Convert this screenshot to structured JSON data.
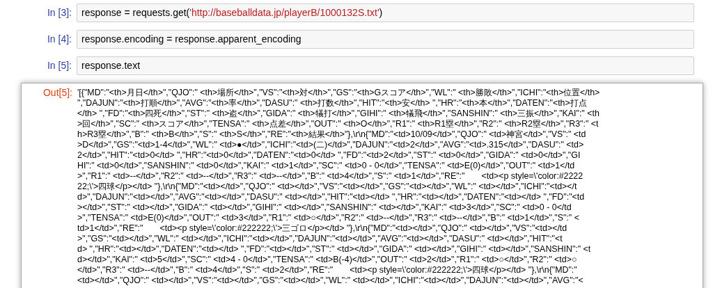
{
  "cells": [
    {
      "kind": "input",
      "prompt": "In [3]:",
      "code": [
        {
          "kind": "plain",
          "text": "response = requests.get("
        },
        {
          "kind": "string",
          "text": "'http://baseballdata.jp/playerB/1000132S.txt'"
        },
        {
          "kind": "plain",
          "text": ")"
        }
      ]
    },
    {
      "kind": "input",
      "prompt": "In [4]:",
      "code": [
        {
          "kind": "plain",
          "text": "response.encoding = response.apparent_encoding"
        }
      ]
    },
    {
      "kind": "input",
      "prompt": "In [5]:",
      "code": [
        {
          "kind": "plain",
          "text": "response.text"
        }
      ]
    },
    {
      "kind": "output",
      "prompt": "Out[5]:",
      "lines": [
        "'[{\"MD\":\"<th>月日</th>\",\"QJO\":\" <th>場所</th>\",\"VS\":\"<th>対</th>\",\"GS\":\"<th>Gスコア</th>\",\"WL\":\" <th>勝敗</th>\",\"ICHI\":\"<th>位置</th>",
        "\",\"DAJUN\":\"<th>打順</th>\",\"AVG\":\"<th>率</th>\",\"DASU\":\" <th>打数</th>\",\"HIT\":\"<th>安</th> \",\"HR\":\"<th>本</th>\",\"DATEN\":\"<th>打点",
        "</th> \",\"FD\":\"<th>四死</th>\",\"ST\":\" <th>盗</th>\",\"GIDA\":\" <th>犠打</th>\",\"GIHI\":\" <th>犠飛</th>\",\"SANSHIN\":\" <th>三振</th>\",\"KAI\":\" <th",
        ">回</th>\",\"SC\":\" <th>スコア</th>\",\"TENSA\":\" <th>点差</th>\",\"OUT\":\" <th>O</th>\",\"R1\":\" <th>R1塁</th>\",\"R2\":\" <th>R2塁</th>\",\"R3\":\" <t",
        "h>R3塁</th>\",\"B\":\" <th>B</th>\",\"S\":\" <th>S</th>\",\"RE\":\"<th>結果</th>\"},\\r\\n{\"MD\":\"<td>10/09</td>\",\"QJO\":\" <td>神宮</td>\",\"VS\":\" <td",
        ">D</td>\",\"GS\":\"<td>1-4</td>\",\"WL\":\" <td>●</td>\",\"ICHI\":\"<td>(二)</td>\",\"DAJUN\":\"<td>2</td>\",\"AVG\":\"<td>.315</td>\",\"DASU\":\" <td>",
        "2</td>\",\"HIT\":\"<td>0</td> \",\"HR\":\"<td>0</td>\",\"DATEN\":\"<td>0</td> \",\"FD\":\"<td>2</td>\",\"ST\":\" <td>0</td>\",\"GIDA\":\" <td>0</td>\",\"GI",
        "HI\":\" <td>0</td>\",\"SANSHIN\":\" <td>0</td>\",\"KAI\":\" <td>1</td>\",\"SC\":\" <td>0 - 0</td>\",\"TENSA\":\" <td>E(0)</td>\",\"OUT\":\" <td>1</td",
        ">\",\"R1\":\" <td>--</td>\",\"R2\":\" <td>--</td>\",\"R3\":\" <td>--</td>\",\"B\":\" <td>4</td>\",\"S\":\" <td>1</td>\",\"RE\":\"       <td><p style=\\'color:#2222",
        "22;\\'>四球</p></td> \"},\\r\\n{\"MD\":\"<td></td>\",\"QJO\":\" <td></td>\",\"VS\":\"<td></td>\",\"GS\":\"<td></td>\",\"WL\":\" <td></td>\",\"ICHI\":\"<td></t",
        "d>\",\"DAJUN\":\"<td></td>\",\"AVG\":\"<td></td>\",\"DASU\":\" <td></td>\",\"HIT\":\"<td></td> \",\"HR\":\"<td></td>\",\"DATEN\":\"<td></td> \",\"FD\":\"<td",
        "></td>\",\"ST\":\" <td></td>\",\"GIDA\":\" <td></td>\",\"GIHI\":\" <td></td>\",\"SANSHIN\":\" <td></td>\",\"KAI\":\" <td>3</td>\",\"SC\":\" <td>0 - 0</td",
        ">\",\"TENSA\":\" <td>E(0)</td>\",\"OUT\":\" <td>3</td>\",\"R1\":\" <td>○</td>\",\"R2\":\" <td>--</td>\",\"R3\":\" <td>--</td>\",\"B\":\" <td>1</td>\",\"S\":\" <",
        "td>1</td>\",\"RE\":\"       <td><p style=\\'color:#222222;\\'>三ゴロ</p></td> \"},\\r\\n{\"MD\":\"<td></td>\",\"QJO\":\" <td></td>\",\"VS\":\"<td></td",
        ">\",\"GS\":\"<td></td>\",\"WL\":\" <td></td>\",\"ICHI\":\"<td></td>\",\"DAJUN\":\"<td></td>\",\"AVG\":\"<td></td>\",\"DASU\":\" <td></td>\",\"HIT\":\"<t",
        "d> \",\"HR\":\"<td></td>\",\"DATEN\":\"<td></td> \",\"FD\":\"<td></td>\",\"ST\":\" <td></td>\",\"GIDA\":\" <td></td>\",\"GIHI\":\" <td></td>\",\"SANSHIN\":\" <t",
        "d></td>\",\"KAI\":\" <td>5</td>\",\"SC\":\" <td>4 - 0</td>\",\"TENSA\":\" <td>B(-4)</td>\",\"OUT\":\" <td>2</td>\",\"R1\":\" <td>○</td>\",\"R2\":\" <td>○",
        "</td>\",\"R3\":\" <td>--</td>\",\"B\":\" <td>4</td>\",\"S\":\" <td>2</td>\",\"RE\":\"       <td><p style=\\'color:#222222;\\'>四球</p></td> \"},\\r\\n{\"MD\":\"",
        "<td></td>\",\"QJO\":\" <td></td>\",\"VS\":\"<td></td>\",\"GS\":\"<td></td>\",\"WL\":\" <td></td>\",\"ICHI\":\"<td></td>\",\"DAJUN\":\"<td></td>\",\"AVG\":\"<"
      ]
    }
  ]
}
